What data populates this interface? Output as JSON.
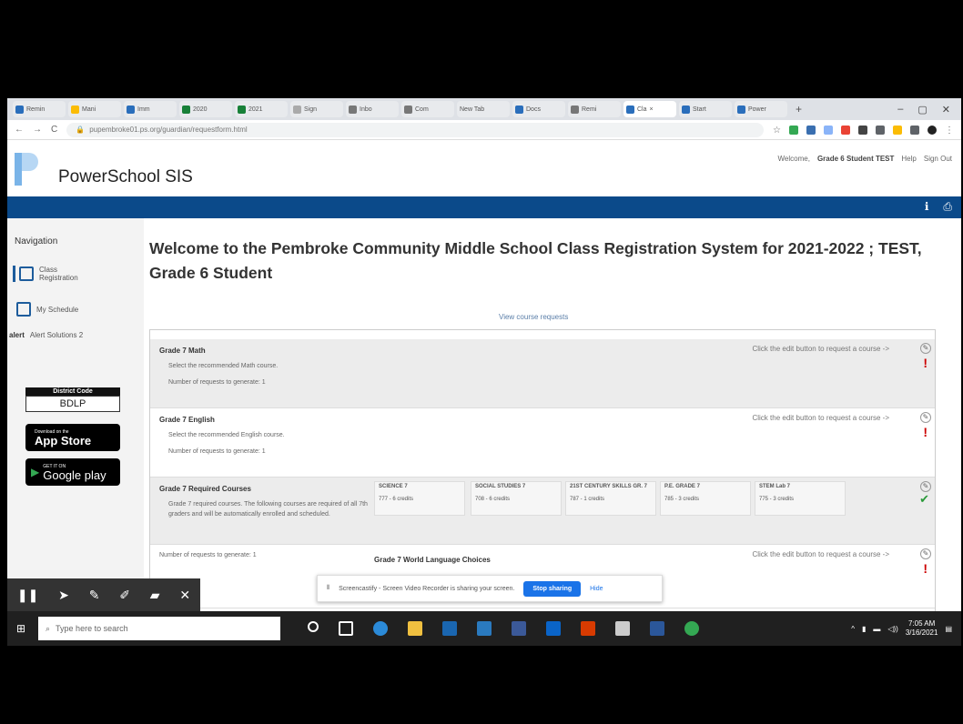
{
  "colors": {
    "brand_blue": "#0b4a8a",
    "accent_blue": "#1a73e8",
    "required_red": "#cc0000",
    "done_green": "#2a9a3a"
  },
  "browser": {
    "tabs": [
      "Remin",
      "Mani",
      "Imm",
      "2020",
      "2021",
      "Sign",
      "Inbo",
      "Com",
      "New Tab",
      "Docs",
      "Remi",
      "Cla",
      "Start",
      "Power"
    ],
    "new_tab": "+",
    "url": "pupembroke01.ps.org/guardian/requestform.html"
  },
  "header": {
    "app_name": "PowerSchool SIS",
    "welcome_prefix": "Welcome,",
    "user_name": "Grade 6 Student TEST",
    "help": "Help",
    "sign_out": "Sign Out"
  },
  "sidebar": {
    "heading": "Navigation",
    "items": [
      {
        "label": "Class Registration",
        "icon": "registration-icon"
      },
      {
        "label": "My Schedule",
        "icon": "calendar-icon"
      },
      {
        "label": "Alert Solutions 2",
        "icon": "alert-icon"
      }
    ],
    "district_code_label": "District Code",
    "district_code": "BDLP",
    "app_store_small": "Download on the",
    "app_store": "App Store",
    "google_play_small": "GET IT ON",
    "google_play": "Google play"
  },
  "main": {
    "title": "Welcome to the Pembroke Community Middle School Class Registration System for 2021-2022 ; TEST, Grade 6 Student",
    "view_requests_link": "View course requests",
    "edit_hint": "Click the edit button to request a course ->",
    "rows": [
      {
        "title": "Grade 7 Math",
        "desc": "Select the recommended Math course.",
        "count": "Number of requests to generate: 1"
      },
      {
        "title": "Grade 7 English",
        "desc": "Select the recommended English course.",
        "count": "Number of requests to generate: 1"
      },
      {
        "title": "Grade 7 Required Courses",
        "desc": "Grade 7 required courses. The following courses are required of all 7th graders and will be automatically enrolled and scheduled.",
        "count": "Number of requests to generate: 1"
      },
      {
        "title": "Grade 7 World Language Choices"
      }
    ],
    "required_courses": [
      {
        "name": "SCIENCE 7",
        "credit": "777 - 6 credits"
      },
      {
        "name": "SOCIAL STUDIES 7",
        "credit": "708 - 6 credits"
      },
      {
        "name": "21ST CENTURY SKILLS GR. 7",
        "credit": "787 - 1 credits"
      },
      {
        "name": "P.E. GRADE 7",
        "credit": "785 - 3 credits"
      },
      {
        "name": "STEM Lab 7",
        "credit": "775 - 3 credits"
      }
    ]
  },
  "share_bar": {
    "message": "Screencastify - Screen Video Recorder is sharing your screen.",
    "stop": "Stop sharing",
    "hide": "Hide"
  },
  "taskbar": {
    "search_placeholder": "Type here to search",
    "time": "7:05 AM",
    "date": "3/16/2021"
  }
}
